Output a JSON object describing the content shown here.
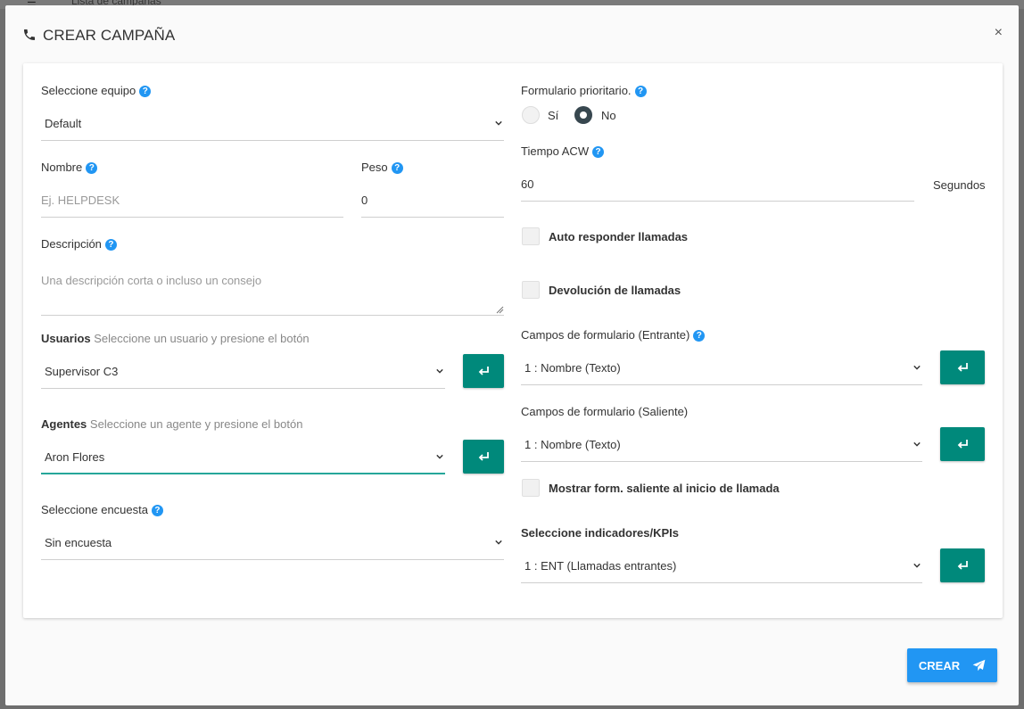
{
  "background": {
    "title_fragment": "Lista de campañas"
  },
  "modal": {
    "title": "CREAR CAMPAÑA",
    "close_glyph": "×",
    "submit_label": "CREAR"
  },
  "left": {
    "team": {
      "label": "Seleccione equipo",
      "value": "Default"
    },
    "name": {
      "label": "Nombre",
      "placeholder": "Ej. HELPDESK"
    },
    "weight": {
      "label": "Peso",
      "value": "0"
    },
    "description": {
      "label": "Descripción",
      "placeholder": "Una descripción corta o incluso un consejo"
    },
    "users": {
      "label": "Usuarios",
      "hint": "Seleccione un usuario y presione el botón",
      "value": "Supervisor C3"
    },
    "agents": {
      "label": "Agentes",
      "hint": "Seleccione un agente y presione el botón",
      "value": "Aron Flores"
    },
    "survey": {
      "label": "Seleccione encuesta",
      "value": "Sin encuesta"
    }
  },
  "right": {
    "priority_form": {
      "label": "Formulario prioritario.",
      "options": [
        "Sí",
        "No"
      ],
      "selected": "No"
    },
    "acw": {
      "label": "Tiempo ACW",
      "value": "60",
      "unit": "Segundos"
    },
    "auto_answer": {
      "label": "Auto responder llamadas",
      "checked": false
    },
    "callback": {
      "label": "Devolución de llamadas",
      "checked": false
    },
    "inbound_fields": {
      "label": "Campos de formulario (Entrante)",
      "value": "1 : Nombre (Texto)"
    },
    "outbound_fields": {
      "label": "Campos de formulario (Saliente)",
      "value": "1 : Nombre (Texto)"
    },
    "show_outbound": {
      "label": "Mostrar form. saliente al inicio de llamada",
      "checked": false
    },
    "kpis": {
      "label": "Seleccione indicadores/KPIs",
      "value": "1 : ENT (Llamadas entrantes)"
    }
  },
  "icons": {
    "help": "question-circle-icon",
    "add": "enter-arrow-icon",
    "chevron": "chevron-down-icon",
    "phone": "phone-icon",
    "send": "paper-plane-icon"
  },
  "colors": {
    "teal": "#00897b",
    "primary": "#2196f3",
    "help": "#2196f3",
    "radio_selected": "#37474f"
  }
}
